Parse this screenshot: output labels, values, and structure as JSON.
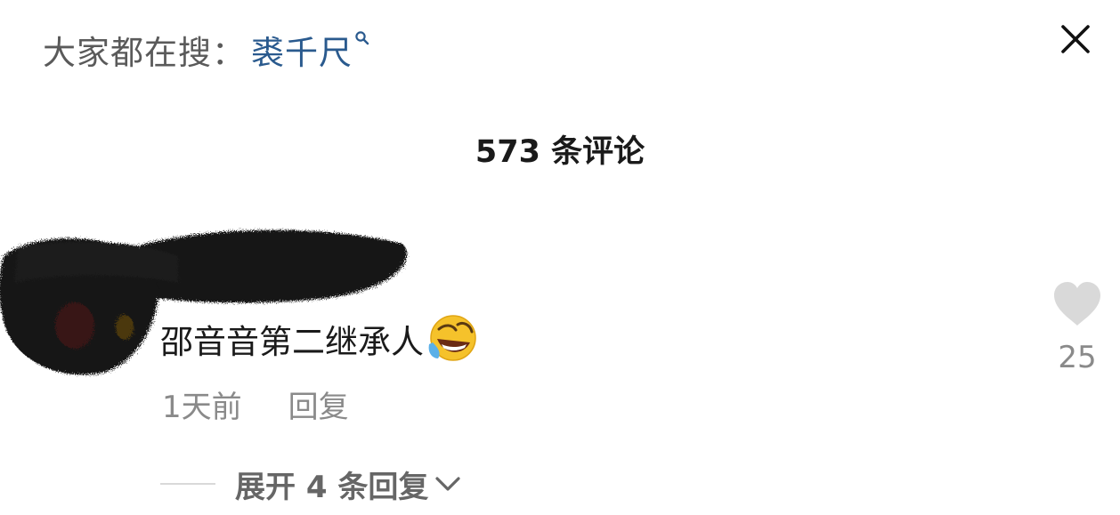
{
  "search": {
    "prefix": "大家都在搜：",
    "term": "裘千尺",
    "term_color": "#2a5a8e"
  },
  "header": {
    "comment_count": "573 条评论"
  },
  "comment": {
    "text": "邵音音第二继承人",
    "emoji": "rolling-on-floor-laughing",
    "time": "1天前",
    "reply_label": "回复",
    "likes": "25"
  },
  "expand": {
    "label": "展开 4 条回复"
  },
  "icons": {
    "close": "close-icon",
    "search": "search-icon",
    "heart": "heart-icon",
    "chevron": "chevron-down-icon"
  }
}
